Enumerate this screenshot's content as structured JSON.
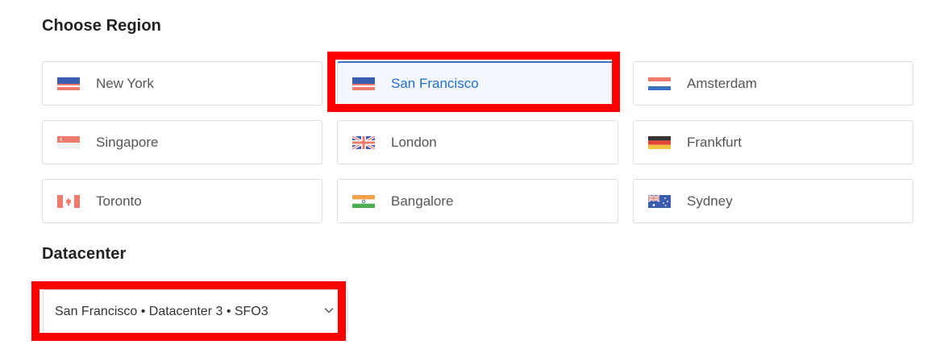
{
  "region_section": {
    "title": "Choose Region",
    "regions": [
      {
        "label": "New York",
        "flag": "flag-us-icon",
        "selected": false
      },
      {
        "label": "San Francisco",
        "flag": "flag-us-icon",
        "selected": true
      },
      {
        "label": "Amsterdam",
        "flag": "flag-nl-icon",
        "selected": false
      },
      {
        "label": "Singapore",
        "flag": "flag-sg-icon",
        "selected": false
      },
      {
        "label": "London",
        "flag": "flag-uk-icon",
        "selected": false
      },
      {
        "label": "Frankfurt",
        "flag": "flag-de-icon",
        "selected": false
      },
      {
        "label": "Toronto",
        "flag": "flag-ca-icon",
        "selected": false
      },
      {
        "label": "Bangalore",
        "flag": "flag-in-icon",
        "selected": false
      },
      {
        "label": "Sydney",
        "flag": "flag-au-icon",
        "selected": false
      }
    ]
  },
  "datacenter_section": {
    "title": "Datacenter",
    "selected_value": "San Francisco • Datacenter 3 • SFO3"
  },
  "colors": {
    "selected_text": "#1f6fd6",
    "annotation": "#ff0000",
    "card_border": "#dddddd"
  }
}
